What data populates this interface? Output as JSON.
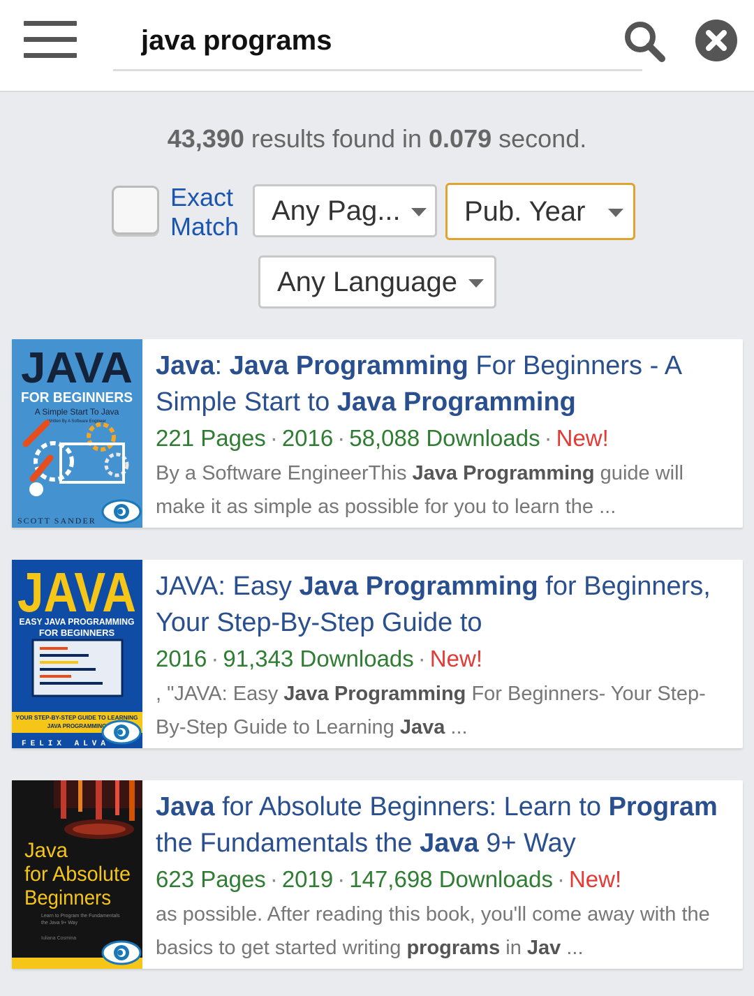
{
  "search": {
    "query": "java programs"
  },
  "results_info": {
    "count": "43,390",
    "middle": " results found in ",
    "time": "0.079",
    "suffix": " second."
  },
  "filters": {
    "exact_match_label_line1": "Exact",
    "exact_match_label_line2": "Match",
    "pages": "Any Pag...",
    "year": "Pub. Year",
    "language": "Any Language"
  },
  "colors": {
    "title": "#2a4f8f",
    "meta_green": "#2e7d32",
    "new_red": "#e53935",
    "exact_blue": "#1a56b0",
    "year_border": "#e0a330"
  },
  "results": [
    {
      "title_parts": [
        {
          "t": "Java",
          "b": true
        },
        {
          "t": ": ",
          "b": false
        },
        {
          "t": "Java Programming",
          "b": true
        },
        {
          "t": " For Beginners - A Simple Start to ",
          "b": false
        },
        {
          "t": "Java Programming",
          "b": true
        }
      ],
      "pages": "221 Pages",
      "year": "2016",
      "downloads": "58,088 Downloads",
      "badge": "New!",
      "desc_parts": [
        {
          "t": "By a Software EngineerThis ",
          "b": false
        },
        {
          "t": "Java Programming",
          "b": true
        },
        {
          "t": " guide will make it as simple as possible for you to learn the  ...",
          "b": false
        }
      ],
      "cover": {
        "title": "JAVA",
        "subtitle": "FOR BEGINNERS",
        "tagline": "A Simple Start To Java",
        "byline": "Written By A Software Engineer",
        "author": "SCOTT SANDER"
      }
    },
    {
      "title_parts": [
        {
          "t": "JAVA",
          "b": false
        },
        {
          "t": ": Easy ",
          "b": false
        },
        {
          "t": "Java Programming",
          "b": true
        },
        {
          "t": " for Beginners, Your Step-By-Step Guide to",
          "b": false
        }
      ],
      "pages": "",
      "year": "2016",
      "downloads": "91,343 Downloads",
      "badge": "New!",
      "desc_parts": [
        {
          "t": ", \"JAVA: Easy ",
          "b": false
        },
        {
          "t": "Java Programming",
          "b": true
        },
        {
          "t": " For Beginners- Your Step-By-Step Guide to Learning ",
          "b": false
        },
        {
          "t": "Java",
          "b": true
        },
        {
          "t": "  ...",
          "b": false
        }
      ],
      "cover": {
        "title": "JAVA",
        "subtitle1": "EASY JAVA PROGRAMMING",
        "subtitle2": "FOR BEGINNERS",
        "banner1": "YOUR STEP-BY-STEP GUIDE TO LEARNING",
        "banner2": "JAVA PROGRAMMING",
        "author": "FELIX ALVA"
      }
    },
    {
      "title_parts": [
        {
          "t": "Java",
          "b": true
        },
        {
          "t": " for Absolute Beginners: Learn to ",
          "b": false
        },
        {
          "t": "Program",
          "b": true
        },
        {
          "t": " the Fundamentals the ",
          "b": false
        },
        {
          "t": "Java",
          "b": true
        },
        {
          "t": " 9+ Way",
          "b": false
        }
      ],
      "pages": "623 Pages",
      "year": "2019",
      "downloads": "147,698 Downloads",
      "badge": "New!",
      "desc_parts": [
        {
          "t": "as possible. After reading this book, you'll come away with the basics to get started writing ",
          "b": false
        },
        {
          "t": "programs",
          "b": true
        },
        {
          "t": " in ",
          "b": false
        },
        {
          "t": "Jav",
          "b": true
        },
        {
          "t": "  ...",
          "b": false
        }
      ],
      "cover": {
        "line1": "Java",
        "line2": "for Absolute",
        "line3": "Beginners",
        "small1": "Learn to Program the Fundamentals",
        "small2": "the Java 9+ Way",
        "author": "Iuliana Cosmina"
      }
    }
  ]
}
